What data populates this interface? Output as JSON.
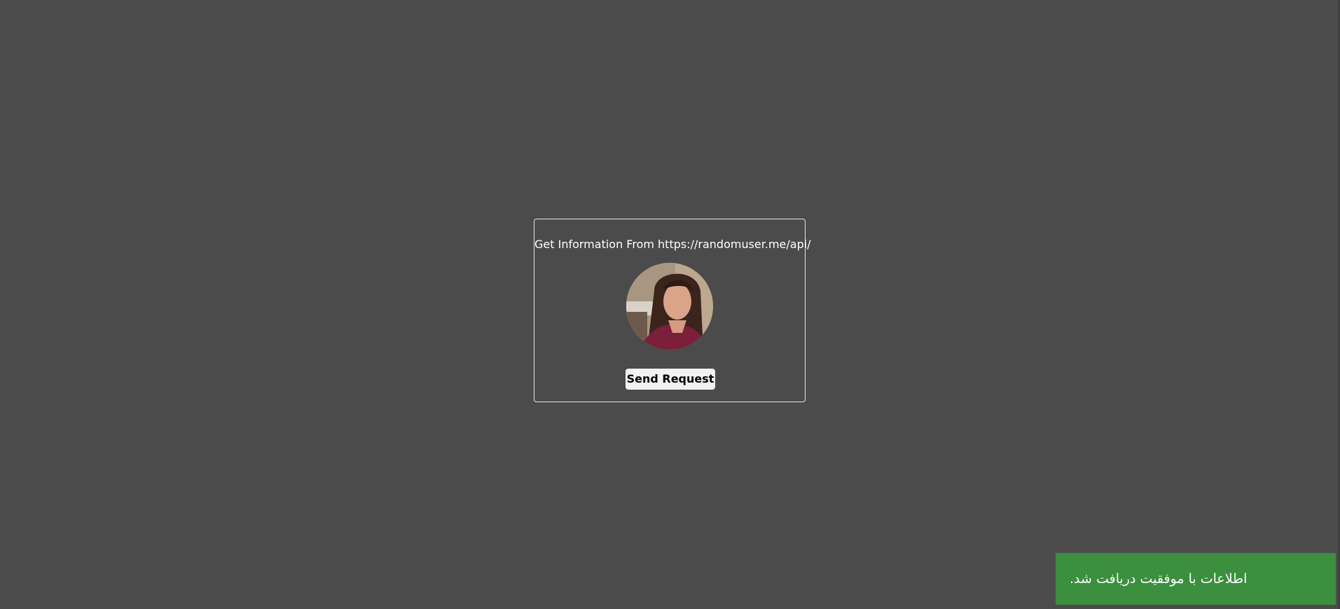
{
  "card": {
    "title": "Get Information From https://randomuser.me/api/",
    "avatar_alt": "user photo",
    "send_button_label": "Send Request"
  },
  "toast": {
    "message": "اطلاعات با موفقیت دریافت شد.",
    "color": "#3b8f3f"
  },
  "colors": {
    "background": "#4b4b4b",
    "card_border": "#e6e6e6",
    "button_bg": "#f1f1f1"
  }
}
